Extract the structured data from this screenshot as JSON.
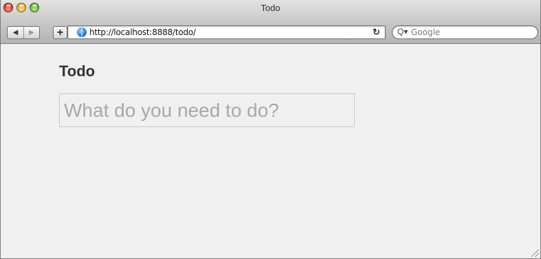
{
  "window": {
    "title": "Todo",
    "traffic_lights": [
      "close",
      "minimize",
      "zoom"
    ]
  },
  "toolbar": {
    "back_icon": "back-arrow-icon",
    "forward_icon": "forward-arrow-icon",
    "add_label": "+",
    "url": "http://localhost:8888/todo/",
    "reload_label": "↻",
    "search_placeholder": "Google"
  },
  "page": {
    "heading": "Todo",
    "new_todo": {
      "placeholder": "What do you need to do?",
      "value": ""
    }
  },
  "colors": {
    "page_background": "#f0f0f0",
    "heading": "#333333",
    "input_border": "#c8c8c8",
    "placeholder": "#a8a8a8"
  }
}
